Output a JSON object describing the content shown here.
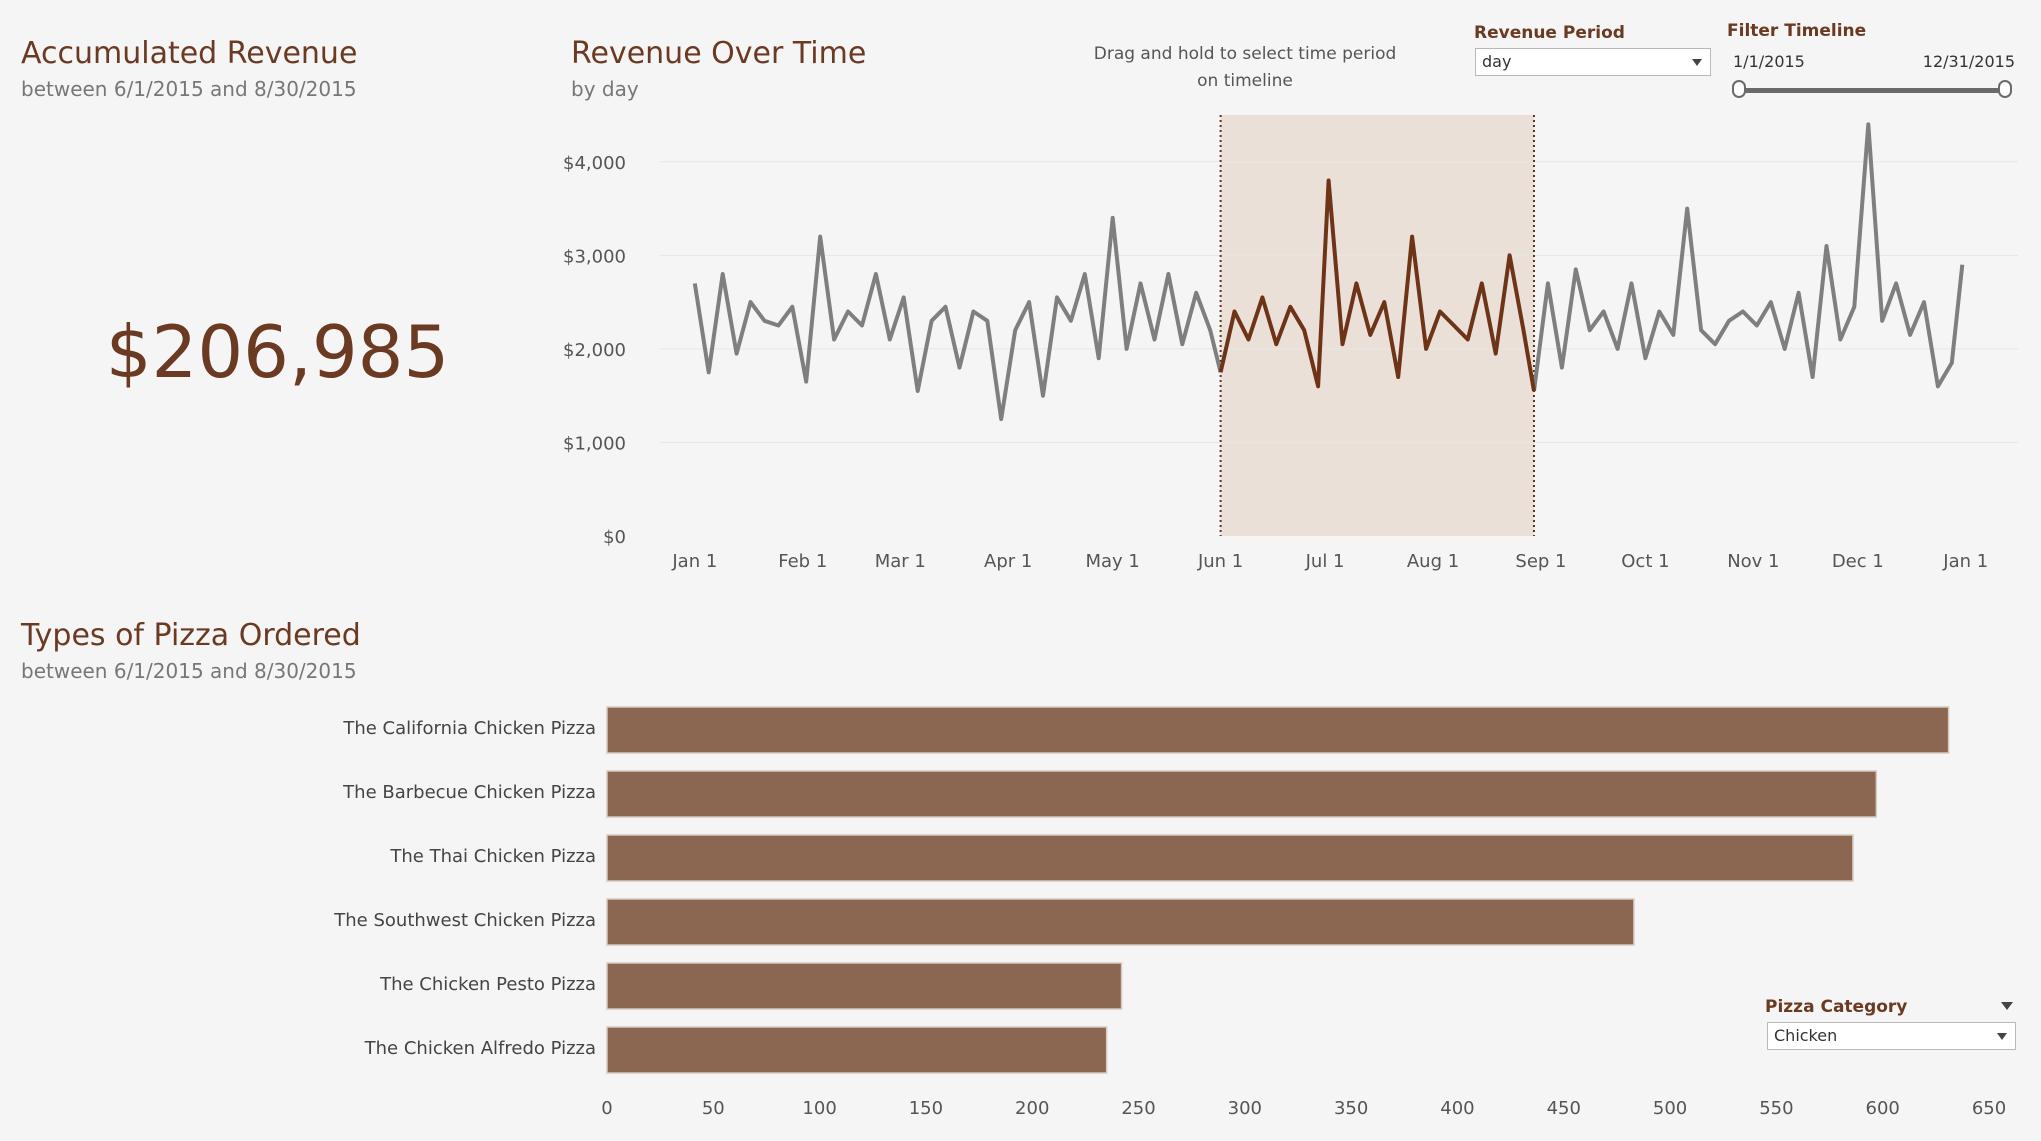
{
  "accumulated": {
    "title": "Accumulated Revenue",
    "subtitle": "between 6/1/2015 and 8/30/2015",
    "value": "$206,985"
  },
  "revenue_chart": {
    "title": "Revenue Over Time",
    "subtitle": "by day",
    "hint": "Drag and hold to select time period on timeline"
  },
  "controls": {
    "revenue_period_label": "Revenue Period",
    "revenue_period_value": "day",
    "filter_timeline_label": "Filter Timeline",
    "timeline_start": "1/1/2015",
    "timeline_end": "12/31/2015",
    "timeline_range": [
      0,
      1
    ],
    "pizza_category_label": "Pizza Category",
    "pizza_category_value": "Chicken"
  },
  "pizza": {
    "title": "Types of Pizza Ordered",
    "subtitle": "between 6/1/2015 and 8/30/2015"
  },
  "colors": {
    "accent": "#6b3a22",
    "bar": "#8b6650",
    "line": "#7f7f7f",
    "highlight_line": "#6e3418",
    "selection_fill": "#ebe0d8"
  },
  "chart_data": [
    {
      "type": "line",
      "title": "Revenue Over Time",
      "subtitle": "by day",
      "x_tick_labels": [
        "Jan 1",
        "Feb 1",
        "Mar 1",
        "Apr 1",
        "May 1",
        "Jun 1",
        "Jul 1",
        "Aug 1",
        "Sep 1",
        "Oct 1",
        "Nov 1",
        "Dec 1",
        "Jan 1"
      ],
      "y_tick_labels": [
        "$0",
        "$1,000",
        "$2,000",
        "$3,000",
        "$4,000"
      ],
      "ylim": [
        0,
        4500
      ],
      "selection": [
        "2015-06-01",
        "2015-08-30"
      ],
      "grid": "horizontal",
      "x": [
        "2015-01-01",
        "2015-01-05",
        "2015-01-09",
        "2015-01-13",
        "2015-01-17",
        "2015-01-21",
        "2015-01-25",
        "2015-01-29",
        "2015-02-02",
        "2015-02-06",
        "2015-02-10",
        "2015-02-14",
        "2015-02-18",
        "2015-02-22",
        "2015-02-26",
        "2015-03-02",
        "2015-03-06",
        "2015-03-10",
        "2015-03-14",
        "2015-03-18",
        "2015-03-22",
        "2015-03-26",
        "2015-03-30",
        "2015-04-03",
        "2015-04-07",
        "2015-04-11",
        "2015-04-15",
        "2015-04-19",
        "2015-04-23",
        "2015-04-27",
        "2015-05-01",
        "2015-05-05",
        "2015-05-09",
        "2015-05-13",
        "2015-05-17",
        "2015-05-21",
        "2015-05-25",
        "2015-05-29",
        "2015-06-01",
        "2015-06-05",
        "2015-06-09",
        "2015-06-13",
        "2015-06-17",
        "2015-06-21",
        "2015-06-25",
        "2015-06-29",
        "2015-07-02",
        "2015-07-06",
        "2015-07-10",
        "2015-07-14",
        "2015-07-18",
        "2015-07-22",
        "2015-07-26",
        "2015-07-30",
        "2015-08-03",
        "2015-08-07",
        "2015-08-11",
        "2015-08-15",
        "2015-08-19",
        "2015-08-23",
        "2015-08-27",
        "2015-08-30",
        "2015-09-03",
        "2015-09-07",
        "2015-09-11",
        "2015-09-15",
        "2015-09-19",
        "2015-09-23",
        "2015-09-27",
        "2015-10-01",
        "2015-10-05",
        "2015-10-09",
        "2015-10-13",
        "2015-10-17",
        "2015-10-21",
        "2015-10-25",
        "2015-10-29",
        "2015-11-02",
        "2015-11-06",
        "2015-11-10",
        "2015-11-14",
        "2015-11-18",
        "2015-11-22",
        "2015-11-26",
        "2015-11-30",
        "2015-12-04",
        "2015-12-08",
        "2015-12-12",
        "2015-12-16",
        "2015-12-20",
        "2015-12-24",
        "2015-12-28",
        "2015-12-31"
      ],
      "y": [
        2700,
        1750,
        2800,
        1950,
        2500,
        2300,
        2250,
        2450,
        1650,
        3200,
        2100,
        2400,
        2250,
        2800,
        2100,
        2550,
        1550,
        2300,
        2450,
        1800,
        2400,
        2300,
        1250,
        2200,
        2500,
        1500,
        2550,
        2300,
        2800,
        1900,
        3400,
        2000,
        2700,
        2100,
        2800,
        2050,
        2600,
        2200,
        1750,
        2400,
        2100,
        2550,
        2050,
        2450,
        2200,
        1600,
        3800,
        2050,
        2700,
        2150,
        2500,
        1700,
        3200,
        2000,
        2400,
        2250,
        2100,
        2700,
        1950,
        3000,
        2200,
        1550,
        2700,
        1800,
        2850,
        2200,
        2400,
        2000,
        2700,
        1900,
        2400,
        2150,
        3500,
        2200,
        2050,
        2300,
        2400,
        2250,
        2500,
        2000,
        2600,
        1700,
        3100,
        2100,
        2450,
        4400,
        2300,
        2700,
        2150,
        2500,
        1600,
        1850,
        2900
      ],
      "series": [
        {
          "values": "y"
        }
      ]
    },
    {
      "type": "bar",
      "orientation": "horizontal",
      "categories": [
        "The California Chicken Pizza",
        "The Barbecue Chicken Pizza",
        "The Thai Chicken Pizza",
        "The Southwest Chicken Pizza",
        "The Chicken Pesto Pizza",
        "The Chicken Alfredo Pizza"
      ],
      "values": [
        631,
        597,
        586,
        483,
        242,
        235
      ],
      "x_tick_labels": [
        "0",
        "50",
        "100",
        "150",
        "200",
        "250",
        "300",
        "350",
        "400",
        "450",
        "500",
        "550",
        "600",
        "650"
      ],
      "xlim": [
        0,
        650
      ]
    }
  ]
}
